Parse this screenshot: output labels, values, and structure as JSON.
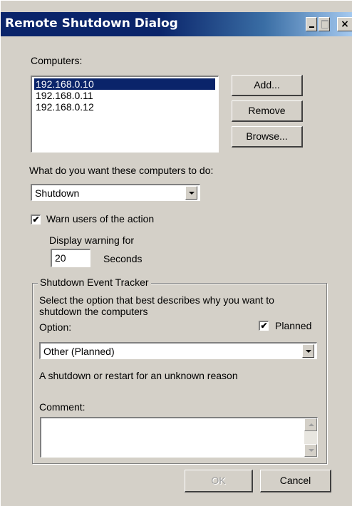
{
  "window": {
    "title": "Remote Shutdown Dialog",
    "controls": {
      "minimize": "_",
      "maximize": "□",
      "close": "×"
    }
  },
  "computers": {
    "label": "Computers:",
    "items": [
      "192.168.0.10",
      "192.168.0.11",
      "192.168.0.12"
    ],
    "selected_index": 0
  },
  "buttons": {
    "add": "Add...",
    "remove": "Remove",
    "browse": "Browse...",
    "ok": "OK",
    "cancel": "Cancel"
  },
  "action": {
    "label": "What do you want these computers to do:",
    "selected": "Shutdown"
  },
  "warn": {
    "label": "Warn users of the action",
    "checked": true
  },
  "warning": {
    "label": "Display warning for",
    "value": "20",
    "unit": "Seconds"
  },
  "tracker": {
    "legend": "Shutdown Event Tracker",
    "description_line1": "Select the option that best describes why you want to",
    "description_line2": "shutdown the computers",
    "option_label": "Option:",
    "planned_label": "Planned",
    "planned_checked": true,
    "option_selected": "Other (Planned)",
    "reason_text": "A shutdown or restart for an unknown reason",
    "comment_label": "Comment:",
    "comment_value": ""
  },
  "check_mark": "✔",
  "colors": {
    "title_bar": "#0a246a",
    "dialog_bg": "#d4d0c8",
    "selection": "#0a246a"
  }
}
